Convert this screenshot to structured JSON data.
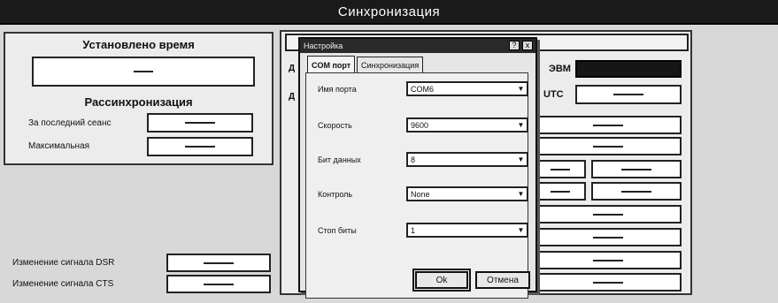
{
  "window": {
    "title": "Синхронизация"
  },
  "left_panel": {
    "time_title": "Установлено время",
    "time_value": "—",
    "desync_title": "Рассинхронизация",
    "rows": [
      {
        "label": "За последний сеанс",
        "value": "—"
      },
      {
        "label": "Максимальная",
        "value": "—"
      }
    ]
  },
  "signals": [
    {
      "label": "Изменение сигнала DSR",
      "value": "—"
    },
    {
      "label": "Изменение сигнала CTS",
      "value": "—"
    }
  ],
  "right_panel": {
    "partial_label_1": "Д",
    "partial_label_2": "Д",
    "evm_label": "ЭВМ",
    "utc_label": "UTC",
    "utc_value": "—",
    "row_values": [
      "—",
      "—",
      "—",
      "—",
      "—",
      "—",
      "—",
      "—",
      "—",
      "—"
    ]
  },
  "dialog": {
    "title": "Настройка",
    "help_button": "?",
    "close_button": "x",
    "tabs": [
      "COM порт",
      "Синхронизация"
    ],
    "active_tab": 0,
    "fields": [
      {
        "label": "Имя порта",
        "value": "COM6"
      },
      {
        "label": "Скорость",
        "value": "9600"
      },
      {
        "label": "Бит данных",
        "value": "8"
      },
      {
        "label": "Контроль",
        "value": "None"
      },
      {
        "label": "Стоп биты",
        "value": "1"
      }
    ],
    "ok_label": "Ok",
    "cancel_label": "Отмена"
  }
}
